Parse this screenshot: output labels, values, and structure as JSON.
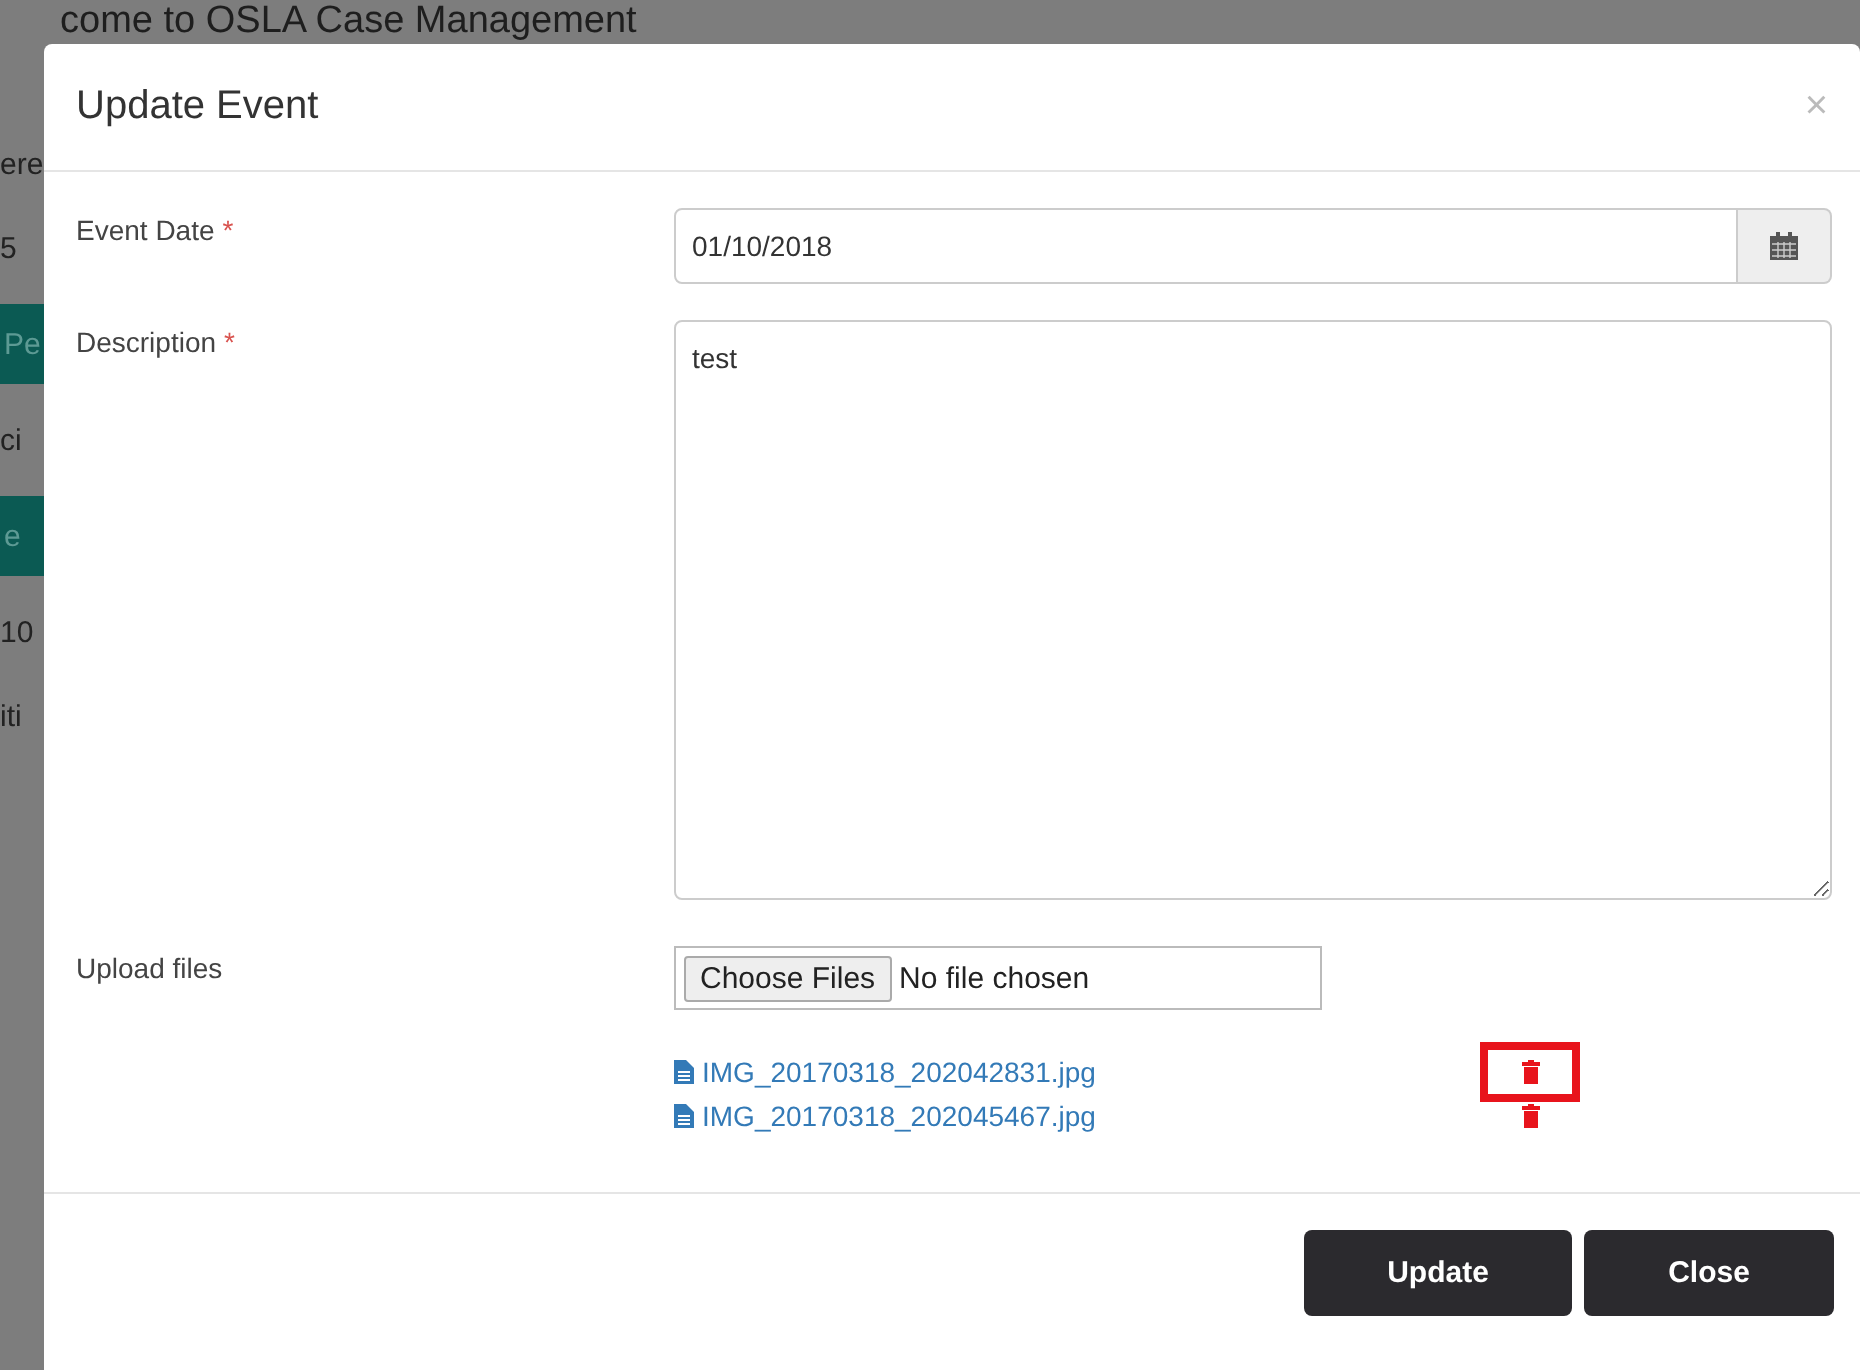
{
  "background_page": {
    "title": "come to OSLA Case Management",
    "fragments": [
      {
        "text": "ere",
        "kind": "plain"
      },
      {
        "text": "5",
        "kind": "plain"
      },
      {
        "text": "Pe",
        "kind": "teal"
      },
      {
        "text": "ci",
        "kind": "plain"
      },
      {
        "text": "e",
        "kind": "teal"
      },
      {
        "text": "10",
        "kind": "plain"
      },
      {
        "text": "iti",
        "kind": "plain"
      }
    ]
  },
  "dialog": {
    "title": "Update Event",
    "close": "×",
    "fields": [
      {
        "label": "Event Date",
        "required": "*",
        "kind": "date",
        "value": "01/10/2018"
      },
      {
        "label": "Description",
        "required": "*",
        "kind": "textarea",
        "value": "test"
      },
      {
        "label": "Upload files",
        "kind": "file",
        "button": "Choose Files",
        "status": "No file chosen"
      }
    ],
    "files": [
      {
        "name": "IMG_20170318_202042831.jpg",
        "highlighted": true
      },
      {
        "name": "IMG_20170318_202045467.jpg",
        "highlighted": false
      }
    ],
    "buttons": [
      "Update",
      "Close"
    ]
  }
}
